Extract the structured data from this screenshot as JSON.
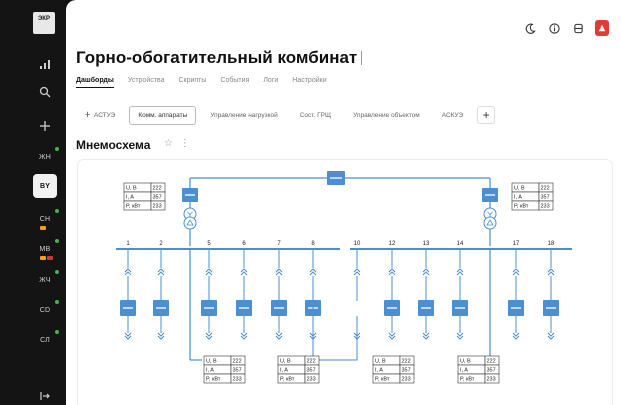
{
  "sidebar": {
    "logo": "ЭКР",
    "items": [
      {
        "label": "",
        "icon": "signal-icon"
      },
      {
        "label": "",
        "icon": "search-icon"
      },
      {
        "label": "",
        "icon": "plus-icon"
      },
      {
        "label": "ЖН"
      },
      {
        "label": "BY",
        "active": true
      },
      {
        "label": "СН"
      },
      {
        "label": "MB"
      },
      {
        "label": "ЖЧ"
      },
      {
        "label": "CD"
      },
      {
        "label": "СЛ"
      },
      {
        "label": "",
        "icon": "logout-icon"
      }
    ]
  },
  "header": {
    "title": "Горно-обогатительный комбинат",
    "nav": [
      "Дашборды",
      "Устройства",
      "Скрипты",
      "События",
      "Логи",
      "Настройки"
    ]
  },
  "tabs": [
    "АСТУЭ",
    "Комм. аппараты",
    "Управление нагрузкой",
    "Сост. ГРЩ",
    "Управление объектом",
    "АСКУЭ"
  ],
  "section": {
    "title": "Мнемосхема"
  },
  "scheme": {
    "feeders": [
      "1",
      "2",
      "5",
      "6",
      "7",
      "8",
      "10",
      "12",
      "13",
      "14",
      "17",
      "18"
    ],
    "meter_labels": [
      "U, В",
      "I, A",
      "P, кВт"
    ],
    "meter_values": [
      "222",
      "357",
      "233"
    ],
    "colors": {
      "line": "#4b8fd1",
      "breaker": "#4b8fd1",
      "accent": "#e53935"
    }
  }
}
